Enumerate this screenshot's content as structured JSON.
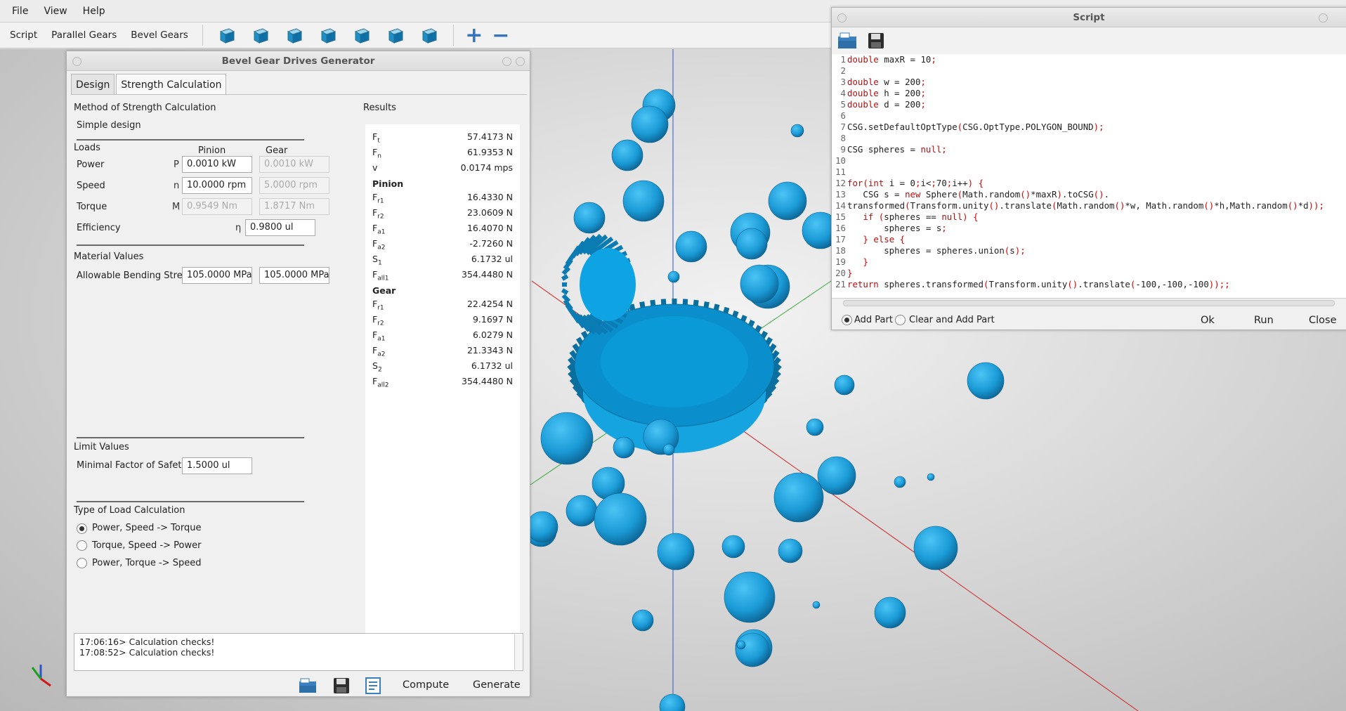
{
  "menubar": {
    "items": [
      "File",
      "View",
      "Help"
    ]
  },
  "toolbar": {
    "script": "Script",
    "parallel": "Parallel Gears",
    "bevel": "Bevel Gears",
    "views": [
      "view-front-icon",
      "view-back-icon",
      "view-left-icon",
      "view-right-icon",
      "view-top-icon",
      "view-bottom-icon",
      "view-iso-icon"
    ],
    "zoom_in": "+",
    "zoom_out": "−"
  },
  "gearwin": {
    "title": "Bevel Gear Drives Generator",
    "tabs": [
      "Design",
      "Strength Calculation"
    ],
    "method_label": "Method of Strength Calculation",
    "method_value": "Simple design",
    "loads": {
      "title": "Loads",
      "col_pinion": "Pinion",
      "col_gear": "Gear",
      "rows": [
        {
          "label": "Power",
          "sym": "P",
          "pinion": "0.0010 kW",
          "gear": "0.0010 kW"
        },
        {
          "label": "Speed",
          "sym": "n",
          "pinion": "10.0000 rpm",
          "gear": "5.0000 rpm"
        },
        {
          "label": "Torque",
          "sym": "M",
          "pinion": "0.9549 Nm",
          "gear": "1.8717 Nm"
        }
      ],
      "efficiency": {
        "label": "Efficiency",
        "sym": "η",
        "value": "0.9800 ul"
      }
    },
    "material": {
      "title": "Material Values",
      "label": "Allowable Bending Stress",
      "pinion": "105.0000 MPa",
      "gear": "105.0000 MPa"
    },
    "limit": {
      "title": "Limit Values",
      "label": "Minimal Factor of Safety",
      "value": "1.5000 ul"
    },
    "loadcalc": {
      "title": "Type of Load Calculation",
      "options": [
        "Power, Speed  -> Torque",
        "Torque, Speed -> Power",
        "Power, Torque -> Speed"
      ],
      "selected": 0
    },
    "results": {
      "title": "Results",
      "general": [
        {
          "k": "F",
          "s": "t",
          "v": "57.4173 N"
        },
        {
          "k": "F",
          "s": "n",
          "v": "61.9353 N"
        },
        {
          "k": "v",
          "s": "",
          "v": "0.0174 mps"
        }
      ],
      "pinion_title": "Pinion",
      "pinion": [
        {
          "k": "F",
          "s": "r1",
          "v": "16.4330 N"
        },
        {
          "k": "F",
          "s": "r2",
          "v": "23.0609 N"
        },
        {
          "k": "F",
          "s": "a1",
          "v": "16.4070 N"
        },
        {
          "k": "F",
          "s": "a2",
          "v": "-2.7260 N"
        },
        {
          "k": "S",
          "s": "1",
          "v": "6.1732 ul"
        },
        {
          "k": "F",
          "s": "all1",
          "v": "354.4480 N"
        }
      ],
      "gear_title": "Gear",
      "gear": [
        {
          "k": "F",
          "s": "r1",
          "v": "22.4254 N"
        },
        {
          "k": "F",
          "s": "r2",
          "v": "9.1697 N"
        },
        {
          "k": "F",
          "s": "a1",
          "v": "6.0279 N"
        },
        {
          "k": "F",
          "s": "a2",
          "v": "21.3343 N"
        },
        {
          "k": "S",
          "s": "2",
          "v": "6.1732 ul"
        },
        {
          "k": "F",
          "s": "all2",
          "v": "354.4480 N"
        }
      ]
    },
    "log": [
      "17:06:16> Calculation checks!",
      "17:08:52> Calculation checks!"
    ],
    "compute": "Compute",
    "generate": "Generate"
  },
  "scriptwin": {
    "title": "Script",
    "code": [
      "double maxR = 10;",
      "",
      "double w = 200;",
      "double h = 200;",
      "double d = 200;",
      "",
      "CSG.setDefaultOptType(CSG.OptType.POLYGON_BOUND);",
      "",
      "CSG spheres = null;",
      "",
      "",
      "for(int i = 0;i<70;i++) {",
      "   CSG s = new Sphere(Math.random()*maxR).toCSG().",
      "transformed(Transform.unity().translate(Math.random()*w, Math.random()*h,Math.random()*d));",
      "   if (spheres == null) {",
      "       spheres = s;",
      "   } else {",
      "       spheres = spheres.union(s);",
      "   }",
      "}",
      "return spheres.transformed(Transform.unity().translate(-100,-100,-100));;"
    ],
    "add_part": "Add Part",
    "clear_add": "Clear and Add Part",
    "ok": "Ok",
    "run": "Run",
    "close": "Close"
  },
  "colors": {
    "accent": "#3573bb",
    "sphere": "#1aa3e0",
    "gear": "#0a9ad8"
  }
}
